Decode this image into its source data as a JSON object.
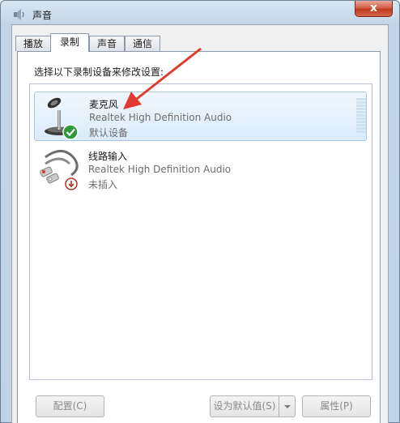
{
  "window": {
    "title": "声音",
    "close_label": "x"
  },
  "tabs": [
    {
      "label": "播放",
      "active": false
    },
    {
      "label": "录制",
      "active": true
    },
    {
      "label": "声音",
      "active": false
    },
    {
      "label": "通信",
      "active": false
    }
  ],
  "instruction": "选择以下录制设备来修改设置:",
  "devices": [
    {
      "name": "麦克风",
      "driver": "Realtek High Definition Audio",
      "status": "默认设备",
      "icon": "microphone-icon",
      "badge": "check-badge-icon"
    },
    {
      "name": "线路输入",
      "driver": "Realtek High Definition Audio",
      "status": "未插入",
      "icon": "line-in-cable-icon",
      "badge": "unplugged-badge-icon"
    }
  ],
  "buttons": {
    "configure": "配置(C)",
    "set_default": "设为默认值(S)",
    "properties": "属性(P)"
  },
  "colors": {
    "selection": "#dbebfb",
    "annotation_arrow": "#e03a2f",
    "close": "#c0391c"
  }
}
